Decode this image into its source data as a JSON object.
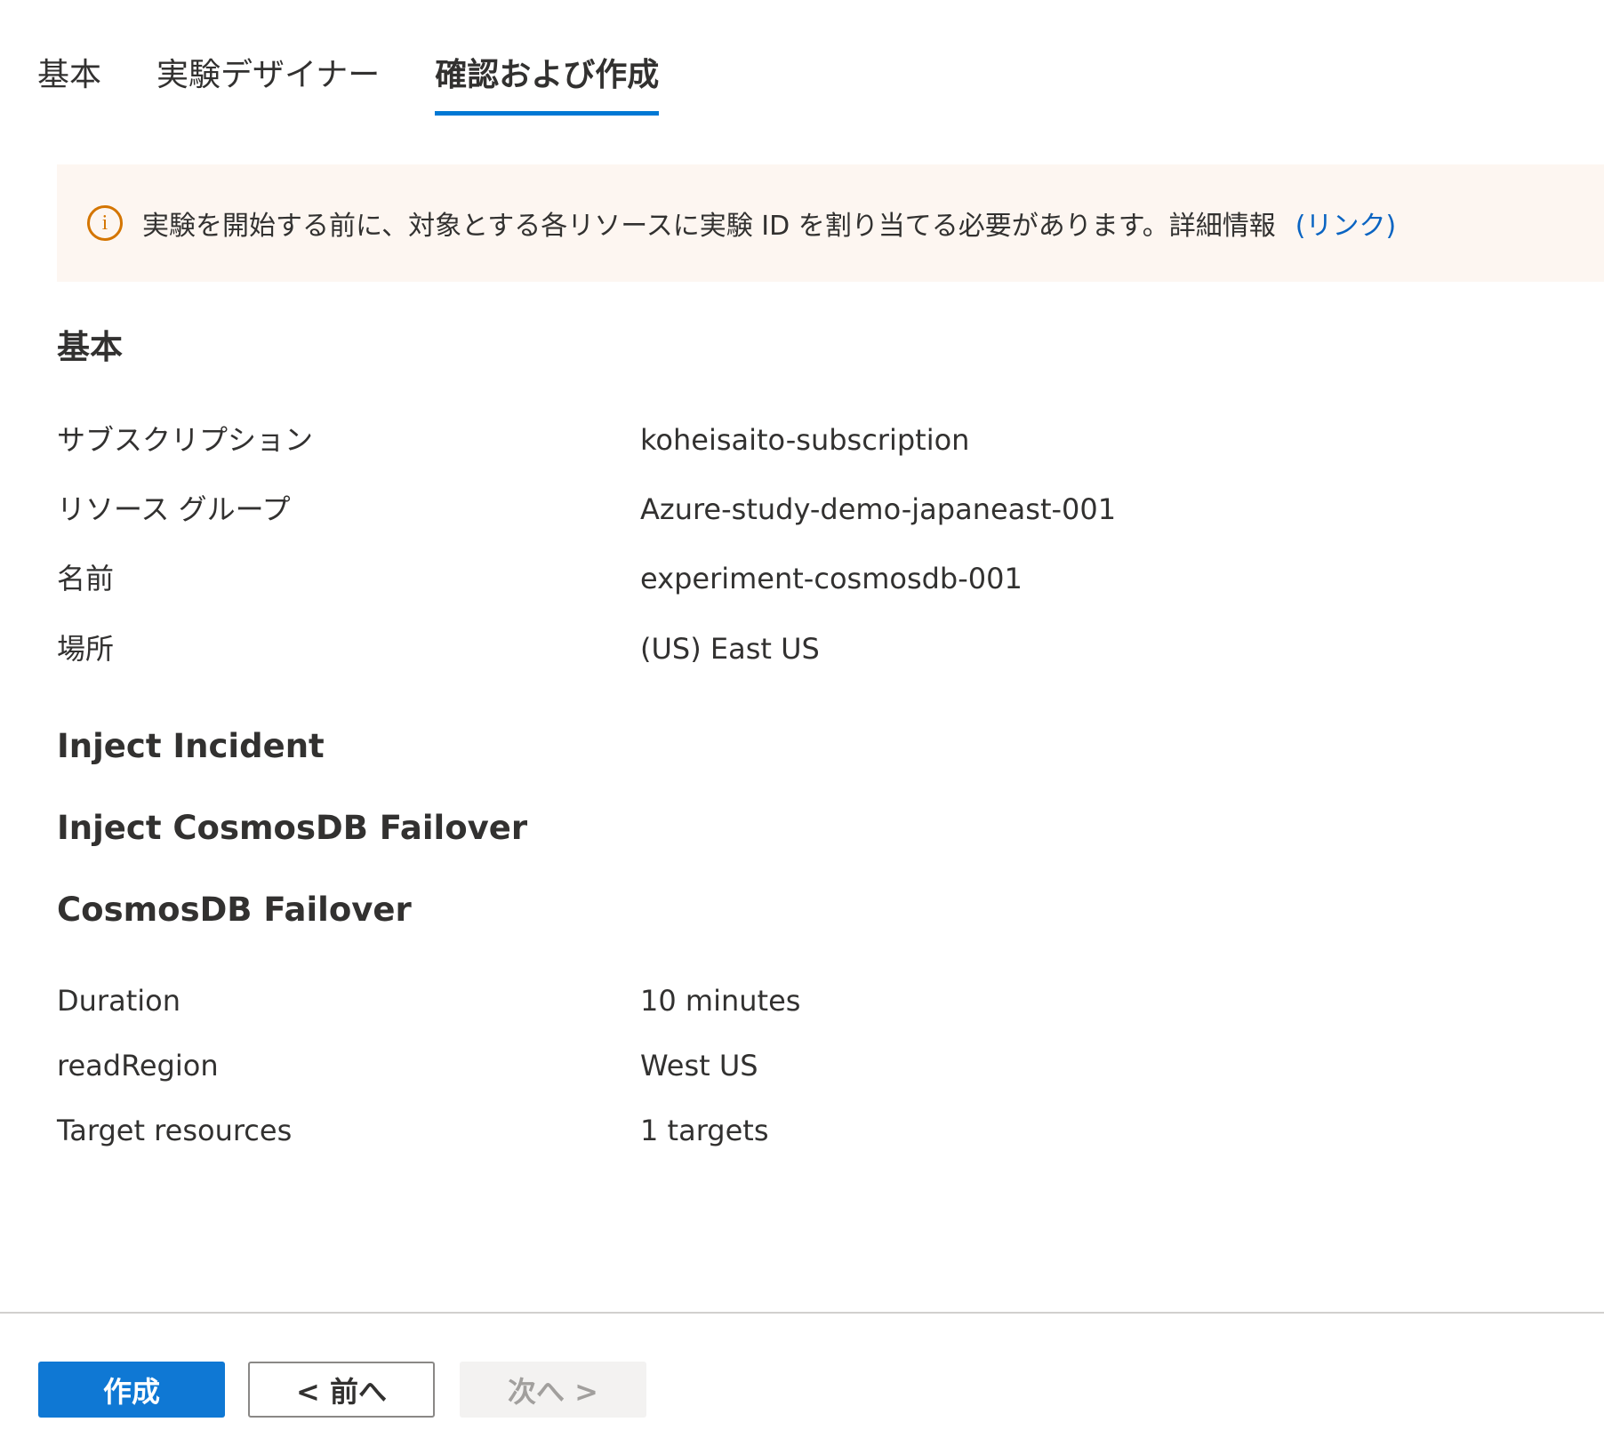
{
  "tabs": [
    {
      "label": "基本"
    },
    {
      "label": "実験デザイナー"
    },
    {
      "label": "確認および作成"
    }
  ],
  "banner": {
    "icon": "info-icon",
    "text": "実験を開始する前に、対象とする各リソースに実験 ID を割り当てる必要があります。詳細情報",
    "link": "(リンク)"
  },
  "basics": {
    "title": "基本",
    "rows": [
      {
        "label": "サブスクリプション",
        "value": "koheisaito-subscription"
      },
      {
        "label": "リソース グループ",
        "value": "Azure-study-demo-japaneast-001"
      },
      {
        "label": "名前",
        "value": "experiment-cosmosdb-001"
      },
      {
        "label": "場所",
        "value": "(US) East US"
      }
    ]
  },
  "step": {
    "title": "Inject Incident"
  },
  "branch": {
    "title": "Inject CosmosDB Failover"
  },
  "action": {
    "title": "CosmosDB Failover",
    "rows": [
      {
        "label": "Duration",
        "value": "10 minutes"
      },
      {
        "label": "readRegion",
        "value": "West US"
      },
      {
        "label": "Target resources",
        "value": "1 targets"
      }
    ]
  },
  "footer": {
    "create_label": "作成",
    "prev_label": "< 前へ",
    "next_label": "次へ >"
  },
  "colors": {
    "accent": "#0078d4",
    "warning": "#d47500",
    "link": "#0a64c2",
    "banner_bg": "#fdf6f1"
  }
}
